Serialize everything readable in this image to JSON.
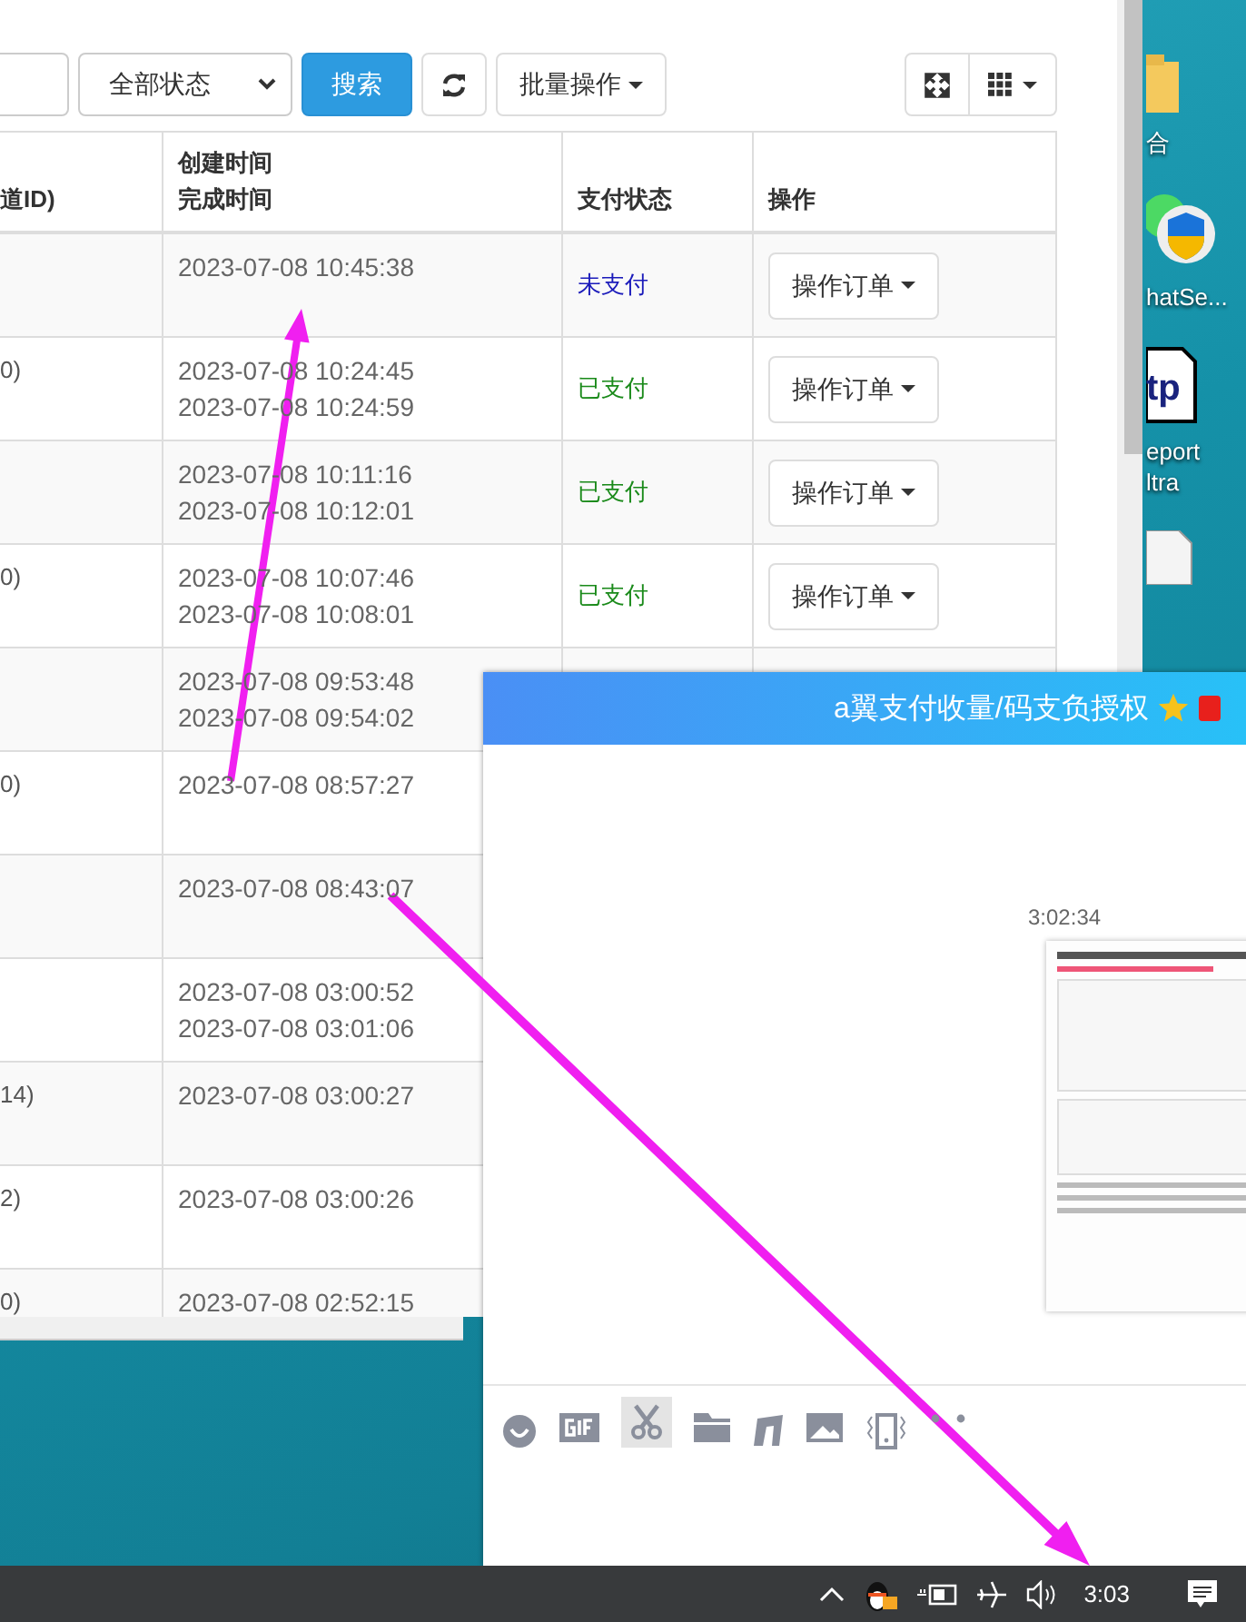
{
  "browser": {
    "toolbar": {
      "status_select": "全部状态",
      "search_button": "搜索",
      "batch_button": "批量操作"
    },
    "table": {
      "columns": [
        {
          "lines": [
            "道ID)"
          ]
        },
        {
          "lines": [
            "创建时间",
            "完成时间"
          ]
        },
        {
          "lines": [
            "支付状态"
          ]
        },
        {
          "lines": [
            "操作"
          ]
        }
      ],
      "rows": [
        {
          "column_1": "",
          "created": "2023-07-08 10:45:38",
          "status": "未支付",
          "paid": false,
          "action": "操作订单"
        },
        {
          "column_1": "0)",
          "created": "2023-07-08 10:24:45",
          "completed": "2023-07-08 10:24:59",
          "status": "已支付",
          "paid": true,
          "action": "操作订单"
        },
        {
          "column_1": "",
          "created": "2023-07-08 10:11:16",
          "completed": "2023-07-08 10:12:01",
          "status": "已支付",
          "paid": true,
          "action": "操作订单"
        },
        {
          "column_1": "0)",
          "created": "2023-07-08 10:07:46",
          "completed": "2023-07-08 10:08:01",
          "status": "已支付",
          "paid": true,
          "action": "操作订单"
        },
        {
          "column_1": "",
          "created": "2023-07-08 09:53:48",
          "completed": "2023-07-08 09:54:02"
        },
        {
          "column_1": "0)",
          "created": "2023-07-08 08:57:27"
        },
        {
          "column_1": "",
          "created": "2023-07-08 08:43:07"
        },
        {
          "column_1": "",
          "created": "2023-07-08 03:00:52",
          "completed": "2023-07-08 03:01:06"
        },
        {
          "column_1": "14)",
          "created": "2023-07-08 03:00:27"
        },
        {
          "column_1": "2)",
          "created": "2023-07-08 03:00:26"
        },
        {
          "column_1": "0)",
          "created": "2023-07-08 02:52:15"
        }
      ]
    }
  },
  "desktop_icons": [
    {
      "kind": "folder",
      "lines": [
        "合"
      ]
    },
    {
      "kind": "shield",
      "lines": [
        "hatSe..."
      ]
    },
    {
      "kind": "document",
      "glyph": "tp",
      "lines": [
        "eport",
        "ltra"
      ]
    },
    {
      "kind": "file"
    }
  ],
  "chat": {
    "title": "a翼支付收量/码支负授权",
    "messages": [
      {
        "kind": "time",
        "text": "3:02:34"
      },
      {
        "kind": "image"
      }
    ]
  },
  "taskbar": {
    "clock": "3:03"
  }
}
